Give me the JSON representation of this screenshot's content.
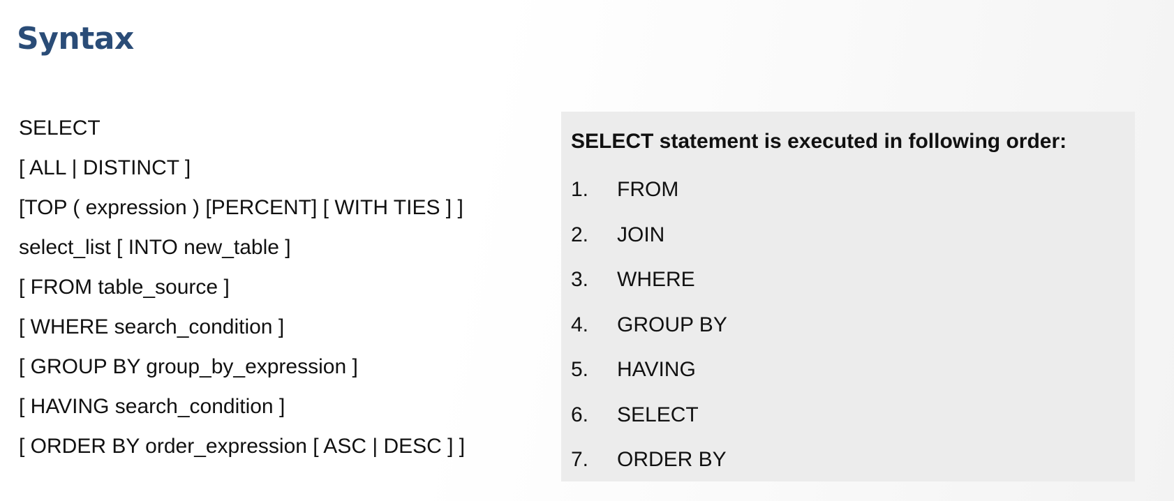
{
  "slide": {
    "title": "Syntax"
  },
  "syntax": {
    "lines": [
      "SELECT",
      "[ ALL | DISTINCT ]",
      "[TOP ( expression ) [PERCENT] [ WITH TIES ] ]",
      "select_list [ INTO new_table ]",
      "[ FROM table_source ]",
      "[ WHERE search_condition ]",
      "[ GROUP BY group_by_expression ]",
      "[ HAVING search_condition ]",
      "[ ORDER BY order_expression [ ASC | DESC ] ]"
    ]
  },
  "order": {
    "heading": "SELECT statement is executed in following order:",
    "items": [
      {
        "num": "1.",
        "label": "FROM"
      },
      {
        "num": "2.",
        "label": "JOIN"
      },
      {
        "num": "3.",
        "label": "WHERE"
      },
      {
        "num": "4.",
        "label": "GROUP BY"
      },
      {
        "num": "5.",
        "label": "HAVING"
      },
      {
        "num": "6.",
        "label": "SELECT"
      },
      {
        "num": "7.",
        "label": "ORDER BY"
      }
    ]
  },
  "colors": {
    "title": "#2a4c77",
    "panel": "#ececec",
    "text": "#111111"
  }
}
